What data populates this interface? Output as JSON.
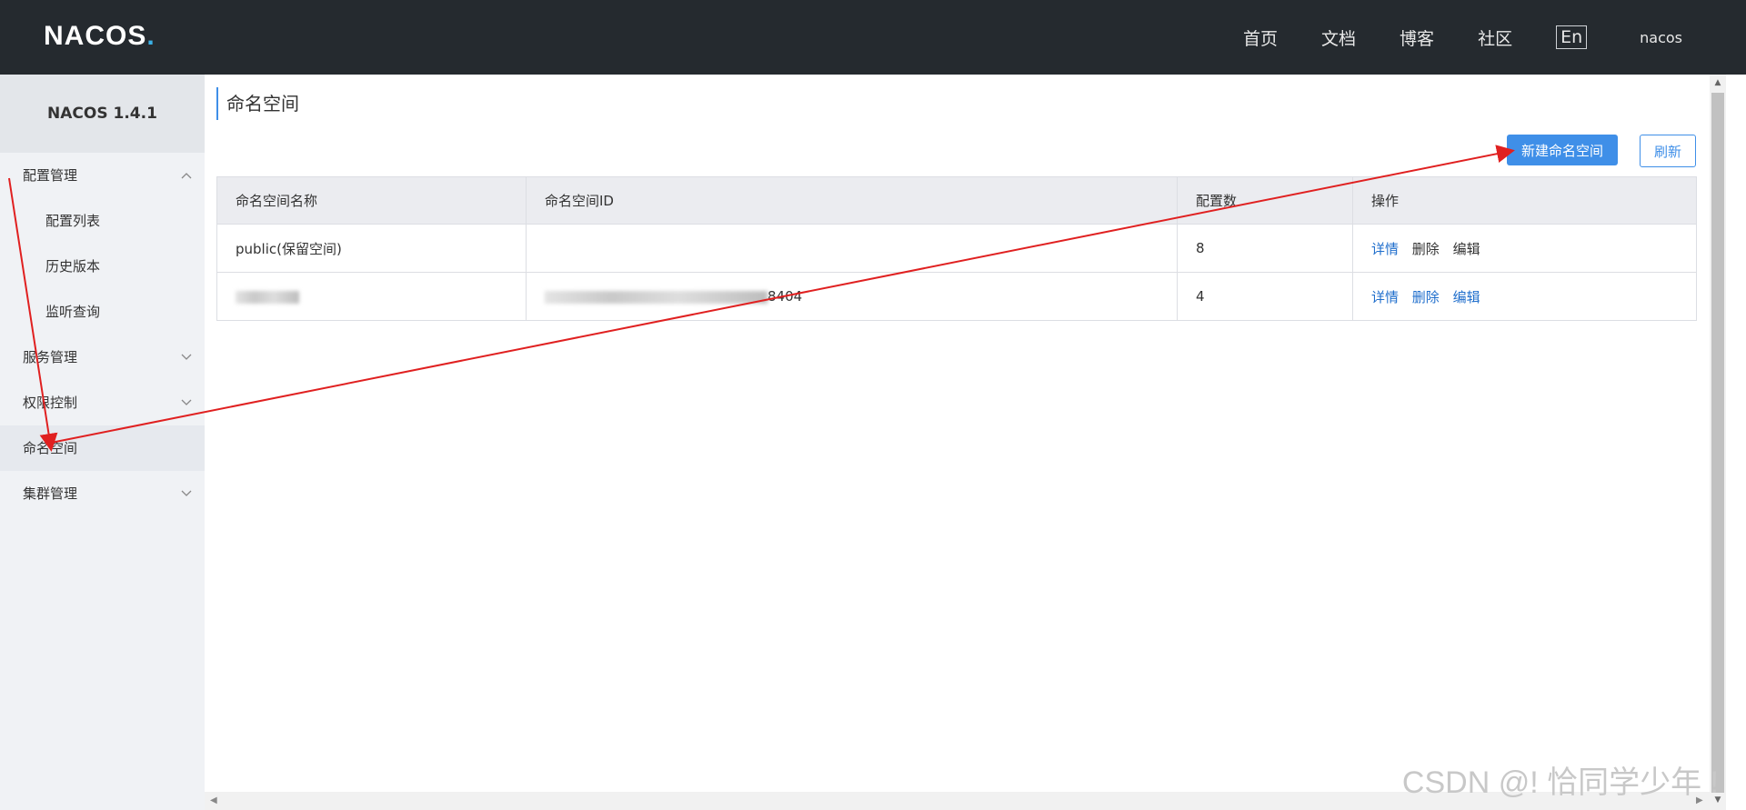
{
  "header": {
    "logo_text": "NACOS",
    "logo_dot": ".",
    "nav": [
      {
        "label": "首页"
      },
      {
        "label": "文档"
      },
      {
        "label": "博客"
      },
      {
        "label": "社区"
      }
    ],
    "lang_button": "En",
    "user": "nacos"
  },
  "sidebar": {
    "title": "NACOS 1.4.1",
    "items": [
      {
        "label": "配置管理",
        "expanded": true
      },
      {
        "label": "配置列表"
      },
      {
        "label": "历史版本"
      },
      {
        "label": "监听查询"
      },
      {
        "label": "服务管理",
        "expanded": false
      },
      {
        "label": "权限控制",
        "expanded": false
      },
      {
        "label": "命名空间",
        "active": true
      },
      {
        "label": "集群管理",
        "expanded": false
      }
    ]
  },
  "main": {
    "title": "命名空间",
    "new_button": "新建命名空间",
    "refresh_button": "刷新",
    "table": {
      "columns": [
        "命名空间名称",
        "命名空间ID",
        "配置数",
        "操作"
      ],
      "rows": [
        {
          "name": "public(保留空间)",
          "id": "",
          "count": "8",
          "ops": [
            "详情",
            "删除",
            "编辑"
          ]
        },
        {
          "name": "",
          "id": "8404",
          "count": "4",
          "ops": [
            "详情",
            "删除",
            "编辑"
          ]
        }
      ]
    }
  },
  "watermark": "CSDN @! 恰同学少年 !",
  "colors": {
    "topbar": "#252a2f",
    "sidebar": "#f0f2f5",
    "primary": "#3f8fe8",
    "link": "#1f6ecc",
    "annotation_arrow": "#e02020"
  },
  "icons": {
    "expanded": "chevron-up-icon",
    "collapsed": "chevron-down-icon"
  }
}
